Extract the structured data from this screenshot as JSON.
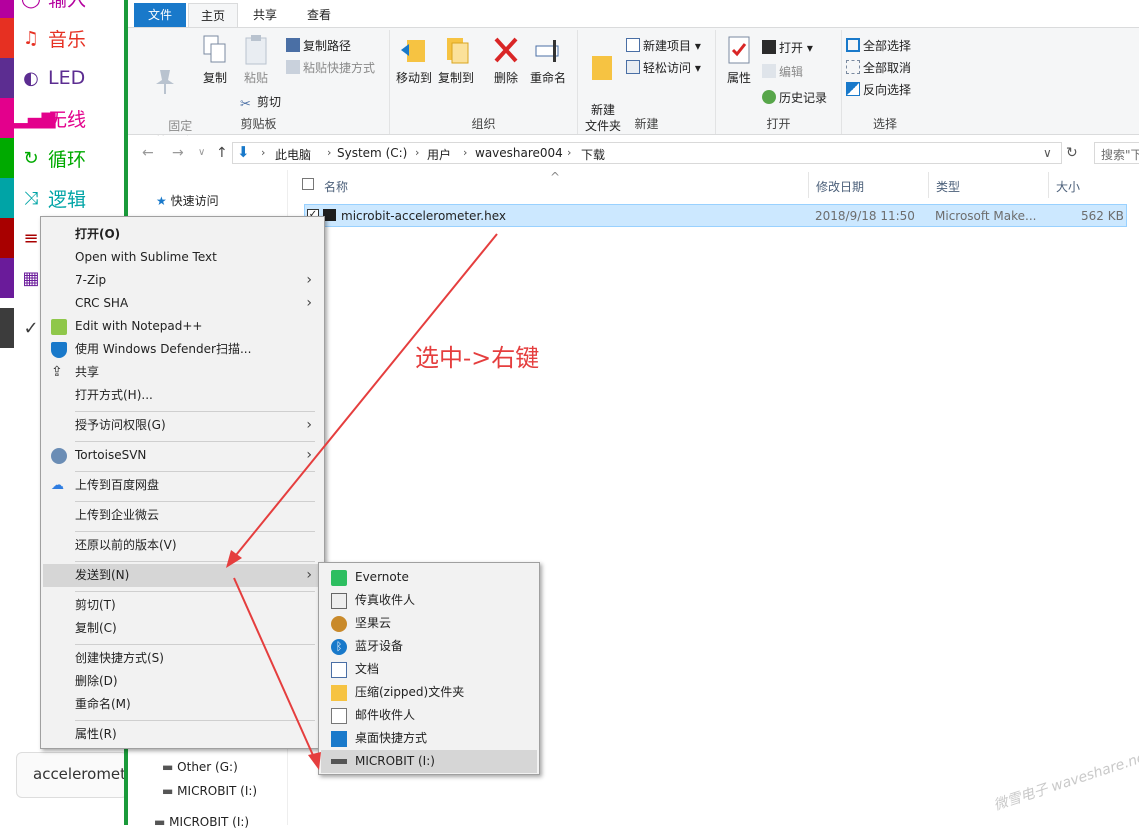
{
  "makecode": {
    "categories": [
      {
        "label": "输入",
        "color": "#b4009e",
        "icon": "circle-icon"
      },
      {
        "label": "音乐",
        "color": "#e63022",
        "icon": "headphones-icon"
      },
      {
        "label": "LED",
        "color": "#5c2d91",
        "icon": "toggle-icon"
      },
      {
        "label": "无线",
        "color": "#e3008c",
        "icon": "signal-icon"
      },
      {
        "label": "循环",
        "color": "#00aa00",
        "icon": "refresh-icon"
      },
      {
        "label": "逻辑",
        "color": "#00a4a6",
        "icon": "shuffle-icon"
      }
    ],
    "search_value": "acceleromet"
  },
  "ribbon": {
    "tabs": [
      "文件",
      "主页",
      "共享",
      "查看"
    ],
    "clipboard": {
      "pin": "固定到\"快速访问\"",
      "copy": "复制",
      "paste": "粘贴",
      "copy_path": "复制路径",
      "paste_shortcut": "粘贴快捷方式",
      "cut": "剪切",
      "label": "剪贴板"
    },
    "organize": {
      "move_to": "移动到",
      "copy_to": "复制到",
      "delete": "删除",
      "rename": "重命名",
      "label": "组织"
    },
    "new": {
      "new_folder": "新建\n文件夹",
      "new_item": "新建项目 ▾",
      "easy_access": "轻松访问 ▾",
      "label": "新建"
    },
    "open": {
      "properties": "属性",
      "open": "打开 ▾",
      "edit": "编辑",
      "history": "历史记录",
      "label": "打开"
    },
    "select": {
      "select_all": "全部选择",
      "select_none": "全部取消",
      "invert": "反向选择",
      "label": "选择"
    }
  },
  "address": {
    "crumbs": [
      "此电脑",
      "System (C:)",
      "用户",
      "waveshare004",
      "下载"
    ],
    "search_placeholder": "搜索\"下"
  },
  "nav": {
    "quick_access": "快速访问",
    "drives": [
      "Other (G:)",
      "MICROBIT (I:)",
      "MICROBIT (I:)"
    ]
  },
  "file_list": {
    "columns": [
      "名称",
      "修改日期",
      "类型",
      "大小"
    ],
    "rows": [
      {
        "name": "microbit-accelerometer.hex",
        "date": "2018/9/18 11:50",
        "type": "Microsoft Make...",
        "size": "562 KB"
      }
    ]
  },
  "context_menu": {
    "items": [
      {
        "label": "打开(O)",
        "bold": true
      },
      {
        "label": "Open with Sublime Text"
      },
      {
        "label": "7-Zip",
        "sub": true
      },
      {
        "label": "CRC SHA",
        "sub": true
      },
      {
        "label": "Edit with Notepad++"
      },
      {
        "label": "使用 Windows Defender扫描..."
      },
      {
        "label": "共享"
      },
      {
        "label": "打开方式(H)..."
      },
      {
        "label": "授予访问权限(G)",
        "sub": true
      },
      {
        "label": "TortoiseSVN",
        "sub": true
      },
      {
        "label": "上传到百度网盘"
      },
      {
        "label": "上传到企业微云"
      },
      {
        "label": "还原以前的版本(V)"
      },
      {
        "label": "发送到(N)",
        "sub": true
      },
      {
        "label": "剪切(T)"
      },
      {
        "label": "复制(C)"
      },
      {
        "label": "创建快捷方式(S)"
      },
      {
        "label": "删除(D)"
      },
      {
        "label": "重命名(M)"
      },
      {
        "label": "属性(R)"
      }
    ]
  },
  "send_to_menu": {
    "items": [
      "Evernote",
      "传真收件人",
      "坚果云",
      "蓝牙设备",
      "文档",
      "压缩(zipped)文件夹",
      "邮件收件人",
      "桌面快捷方式",
      "MICROBIT (I:)"
    ]
  },
  "annotation": "选中->右键",
  "watermark": "微雪电子 waveshare.net",
  "colors": {
    "accent": "#1979ca",
    "selection": "#cce8ff",
    "arrow": "#e53e3e"
  }
}
